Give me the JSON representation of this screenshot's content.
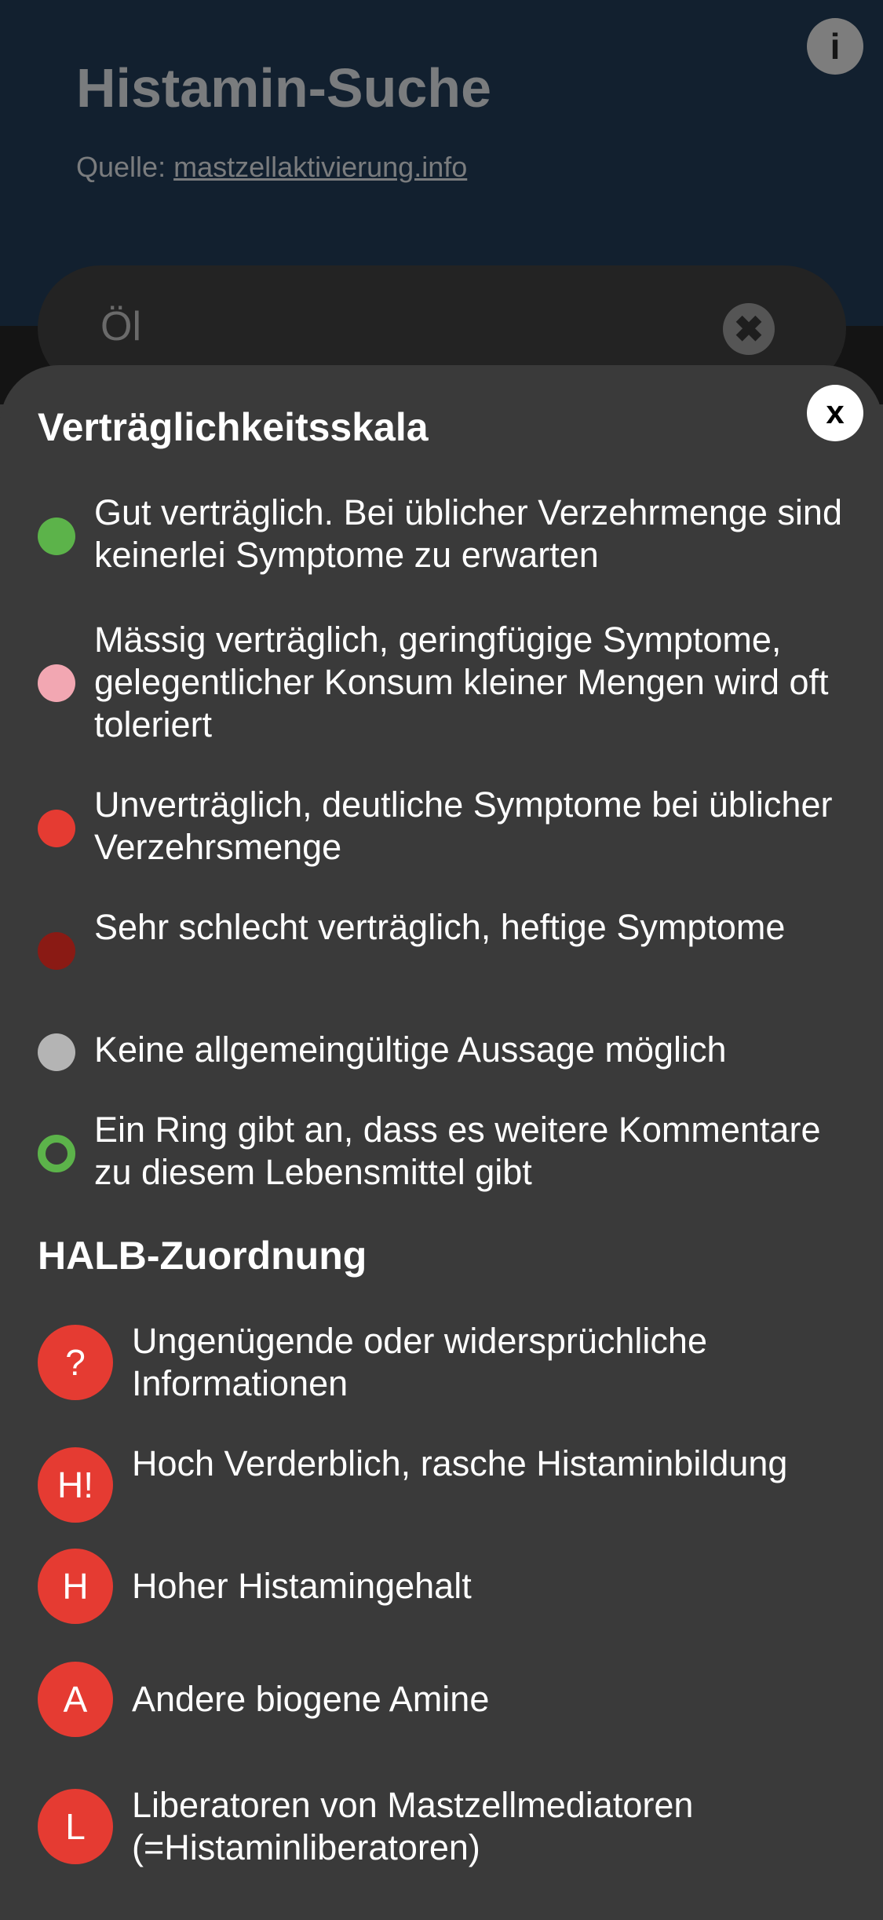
{
  "header": {
    "title": "Histamin-Suche",
    "source_prefix": "Quelle: ",
    "source_link": "mastzellaktivierung.info",
    "info_glyph": "i"
  },
  "search": {
    "value": "Öl",
    "clear_glyph": "✖"
  },
  "sheet": {
    "close_glyph": "x",
    "scale_title": "Verträglichkeitsskala",
    "scale_items": [
      {
        "label": "Gut verträglich. Bei üblicher Verzehrmenge sind keinerlei Symptome zu erwarten",
        "color": "#5cb34a",
        "ring": false
      },
      {
        "label": "Mässig verträglich, geringfügige Symptome, gelegentlicher Konsum kleiner Mengen wird oft toleriert",
        "color": "#f2a7b2",
        "ring": false
      },
      {
        "label": "Unverträglich, deutliche Symptome bei üblicher Verzehrsmenge",
        "color": "#e53b32",
        "ring": false
      },
      {
        "label": "Sehr schlecht verträglich, heftige Symptome",
        "color": "#8a1a14",
        "ring": false
      },
      {
        "label": "Keine allgemeingültige Aussage möglich",
        "color": "#b4b4b4",
        "ring": false
      },
      {
        "label": "Ein Ring gibt an, dass es weitere Kommentare zu diesem Lebensmittel gibt",
        "color": "#5cb34a",
        "ring": true
      }
    ],
    "halb_title": "HALB-Zuordnung",
    "halb_items": [
      {
        "badge": "?",
        "label": "Ungenügende oder widersprüchliche Informationen"
      },
      {
        "badge": "H!",
        "label": "Hoch Verderblich, rasche Histaminbildung"
      },
      {
        "badge": "H",
        "label": "Hoher Histamingehalt"
      },
      {
        "badge": "A",
        "label": "Andere biogene Amine"
      },
      {
        "badge": "L",
        "label": "Liberatoren von Mastzellmediatoren (=Histaminliberatoren)"
      }
    ]
  },
  "colors": {
    "header_bg": "#12202f",
    "sheet_bg": "#3a3a3a",
    "badge_red": "#e53b32"
  }
}
